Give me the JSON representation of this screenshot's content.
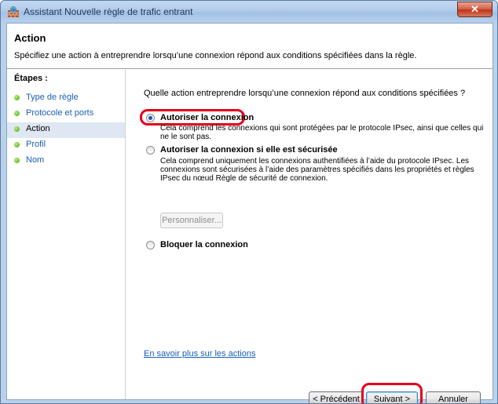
{
  "window": {
    "title": "Assistant Nouvelle règle de trafic entrant",
    "close_glyph": "✕",
    "app_icon": "firewall-icon"
  },
  "header": {
    "title": "Action",
    "subtitle": "Spécifiez une action à entreprendre lorsqu’une connexion répond aux conditions spécifiées dans la règle."
  },
  "steps": {
    "title": "Étapes :",
    "items": [
      {
        "label": "Type de règle",
        "active": false
      },
      {
        "label": "Protocole et ports",
        "active": false
      },
      {
        "label": "Action",
        "active": true
      },
      {
        "label": "Profil",
        "active": false
      },
      {
        "label": "Nom",
        "active": false
      }
    ]
  },
  "main": {
    "question": "Quelle action entreprendre lorsqu’une connexion répond aux conditions spécifiées ?",
    "options": [
      {
        "label": "Autoriser la connexion",
        "checked": true,
        "description_lines": [
          "Cela comprend les connexions qui sont protégées par le protocole IPsec, ainsi que celles qui",
          "ne le sont pas."
        ]
      },
      {
        "label": "Autoriser la connexion si elle est sécurisée",
        "checked": false,
        "description_lines": [
          "Cela comprend uniquement les connexions authentifiées à l’aide du protocole IPsec. Les",
          "connexions sont sécurisées à l’aide des paramètres spécifiés dans les propriétés et règles",
          "IPsec du nœud Règle de sécurité de connexion."
        ]
      },
      {
        "label": "Bloquer la connexion",
        "checked": false,
        "description_lines": []
      }
    ],
    "customize_button": "Personnaliser...",
    "customize_enabled": false,
    "learn_more_link": "En savoir plus sur les actions"
  },
  "footer": {
    "back_button": "< Précédent",
    "next_button": "Suivant >",
    "cancel_button": "Annuler"
  },
  "colors": {
    "highlight": "#e3001b",
    "link": "#1a5fb4",
    "selection": "#dfe7f2",
    "step_bullet": "#45a514"
  }
}
